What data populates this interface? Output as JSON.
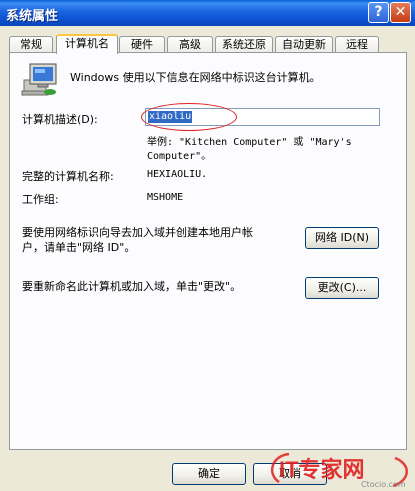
{
  "window": {
    "title": "系统属性"
  },
  "titlebar_buttons": {
    "help": "?",
    "close": "✕"
  },
  "tabs": [
    {
      "label": "常规"
    },
    {
      "label": "计算机名"
    },
    {
      "label": "硬件"
    },
    {
      "label": "高级"
    },
    {
      "label": "系统还原"
    },
    {
      "label": "自动更新"
    },
    {
      "label": "远程"
    }
  ],
  "active_tab": "计算机名",
  "intro": "Windows 使用以下信息在网络中标识这台计算机。",
  "description": {
    "label": "计算机描述(D):",
    "value": "xiaoliu",
    "example_line1": "举例: \"Kitchen Computer\" 或 \"Mary's",
    "example_line2": "Computer\"。"
  },
  "full_name": {
    "label": "完整的计算机名称:",
    "value": "HEXIAOLIU."
  },
  "workgroup": {
    "label": "工作组:",
    "value": "MSHOME"
  },
  "network_id": {
    "text_line1": "要使用网络标识向导去加入域并创建本地用户帐",
    "text_line2": "户，请单击\"网络 ID\"。",
    "button": "网络 ID(N)"
  },
  "rename": {
    "text": "要重新命名此计算机或加入域，单击\"更改\"。",
    "button": "更改(C)..."
  },
  "footer": {
    "ok": "确定",
    "cancel": "取消"
  },
  "watermark": {
    "brand": "IT专家网",
    "sub": "Ctocio.com"
  },
  "colors": {
    "title_bar": "#0a5fd8",
    "selection": "#316ac5",
    "highlight_oval": "#e0201f",
    "tab_accent": "#ffc83c"
  }
}
